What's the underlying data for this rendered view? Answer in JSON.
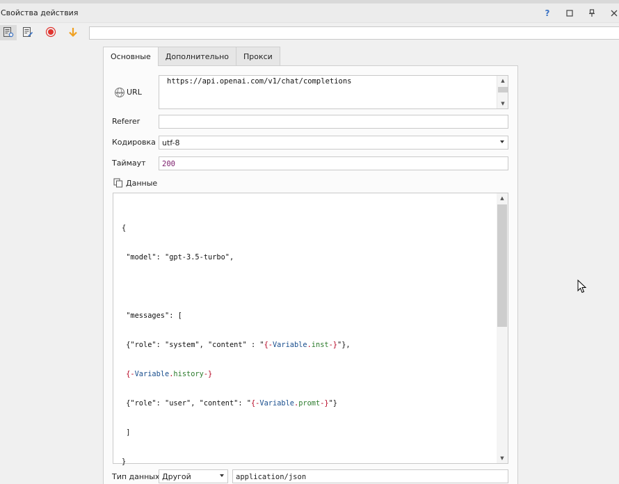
{
  "window": {
    "title": "Свойства действия",
    "controls": {
      "help": "?",
      "maximize": "☐",
      "pin": "⊥",
      "close": "✕"
    }
  },
  "toolbar": {
    "buttons": [
      "properties-settings-icon",
      "edit-properties-icon",
      "record-icon",
      "download-arrow-icon"
    ],
    "input_value": ""
  },
  "tabs": [
    {
      "label": "Основные",
      "active": true
    },
    {
      "label": "Дополнительно",
      "active": false
    },
    {
      "label": "Прокси",
      "active": false
    }
  ],
  "form": {
    "url": {
      "label": "URL",
      "value": "https://api.openai.com/v1/chat/completions"
    },
    "referer": {
      "label": "Referer",
      "value": ""
    },
    "encoding": {
      "label": "Кодировка",
      "value": "utf-8"
    },
    "timeout": {
      "label": "Таймаут",
      "value": "200"
    },
    "data": {
      "label": "Данные",
      "lines": [
        "{",
        " \"model\": \"gpt-3.5-turbo\",",
        "",
        " \"messages\": [",
        " {\"role\": \"system\", \"content\" : \"{-Variable.inst-}\"},",
        " {-Variable.history-}",
        " {\"role\": \"user\", \"content\": \"{-Variable.promt-}\"}",
        " ]",
        "}"
      ]
    },
    "data_type": {
      "label": "Тип данных",
      "value": "Другой",
      "content_type": "application/json"
    }
  },
  "colors": {
    "accent_blue": "#3a72c4",
    "record_red": "#e0342f",
    "download_orange": "#f0a020",
    "variable": "#b5001f"
  }
}
